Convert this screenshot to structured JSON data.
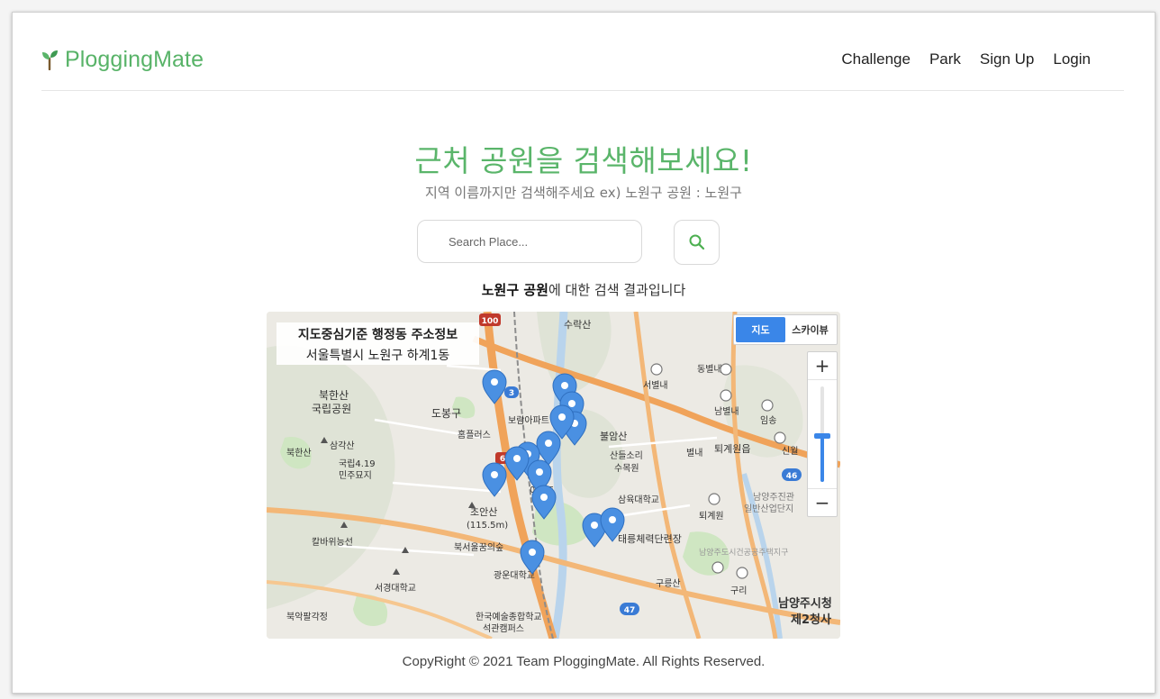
{
  "nav": {
    "brand": "PloggingMate",
    "links": [
      "Challenge",
      "Park",
      "Sign Up",
      "Login"
    ]
  },
  "heading": {
    "title": "근처 공원을 검색해보세요!",
    "subtitle": "지역 이름까지만 검색해주세요 ex) 노원구 공원 : 노원구"
  },
  "search": {
    "placeholder": "Search Place...",
    "value": ""
  },
  "result": {
    "query": "노원구 공원",
    "suffix": "에 대한 검색 결과입니다"
  },
  "map": {
    "info_title": "지도중심기준 행정동 주소정보",
    "info_address": "서울특별시 노원구 하계1동",
    "type_map": "지도",
    "type_skyview": "스카이뷰",
    "zoom_in": "+",
    "zoom_out": "−",
    "marker_color": "#4a90e2",
    "labels": [
      "수락산",
      "동별내",
      "서별내",
      "남별내",
      "임송",
      "신월",
      "북한산",
      "국립공원",
      "북한산",
      "삼각산",
      "도봉구",
      "보람아파트",
      "홈플러스",
      "불암산",
      "산들소리",
      "수목원",
      "별내",
      "퇴계원읍",
      "국립4.19",
      "민주묘지",
      "초안산",
      "(115.5m)",
      "이마트",
      "삼육대학교",
      "퇴계원",
      "남양주진관",
      "일반산업단지",
      "칼바위능선",
      "북서울꿈의숲",
      "태릉체력단련장",
      "남양주도시건공공주택지구",
      "광운대학교",
      "구릉산",
      "구리",
      "서경대학교",
      "북악팔각정",
      "한국예술종합학교",
      "석관캠퍼스",
      "남양주시청",
      "제2청사",
      "100",
      "47",
      "46",
      "3",
      "6"
    ]
  },
  "footer": {
    "text": "CopyRight © 2021 Team PloggingMate. All Rights Reserved."
  }
}
